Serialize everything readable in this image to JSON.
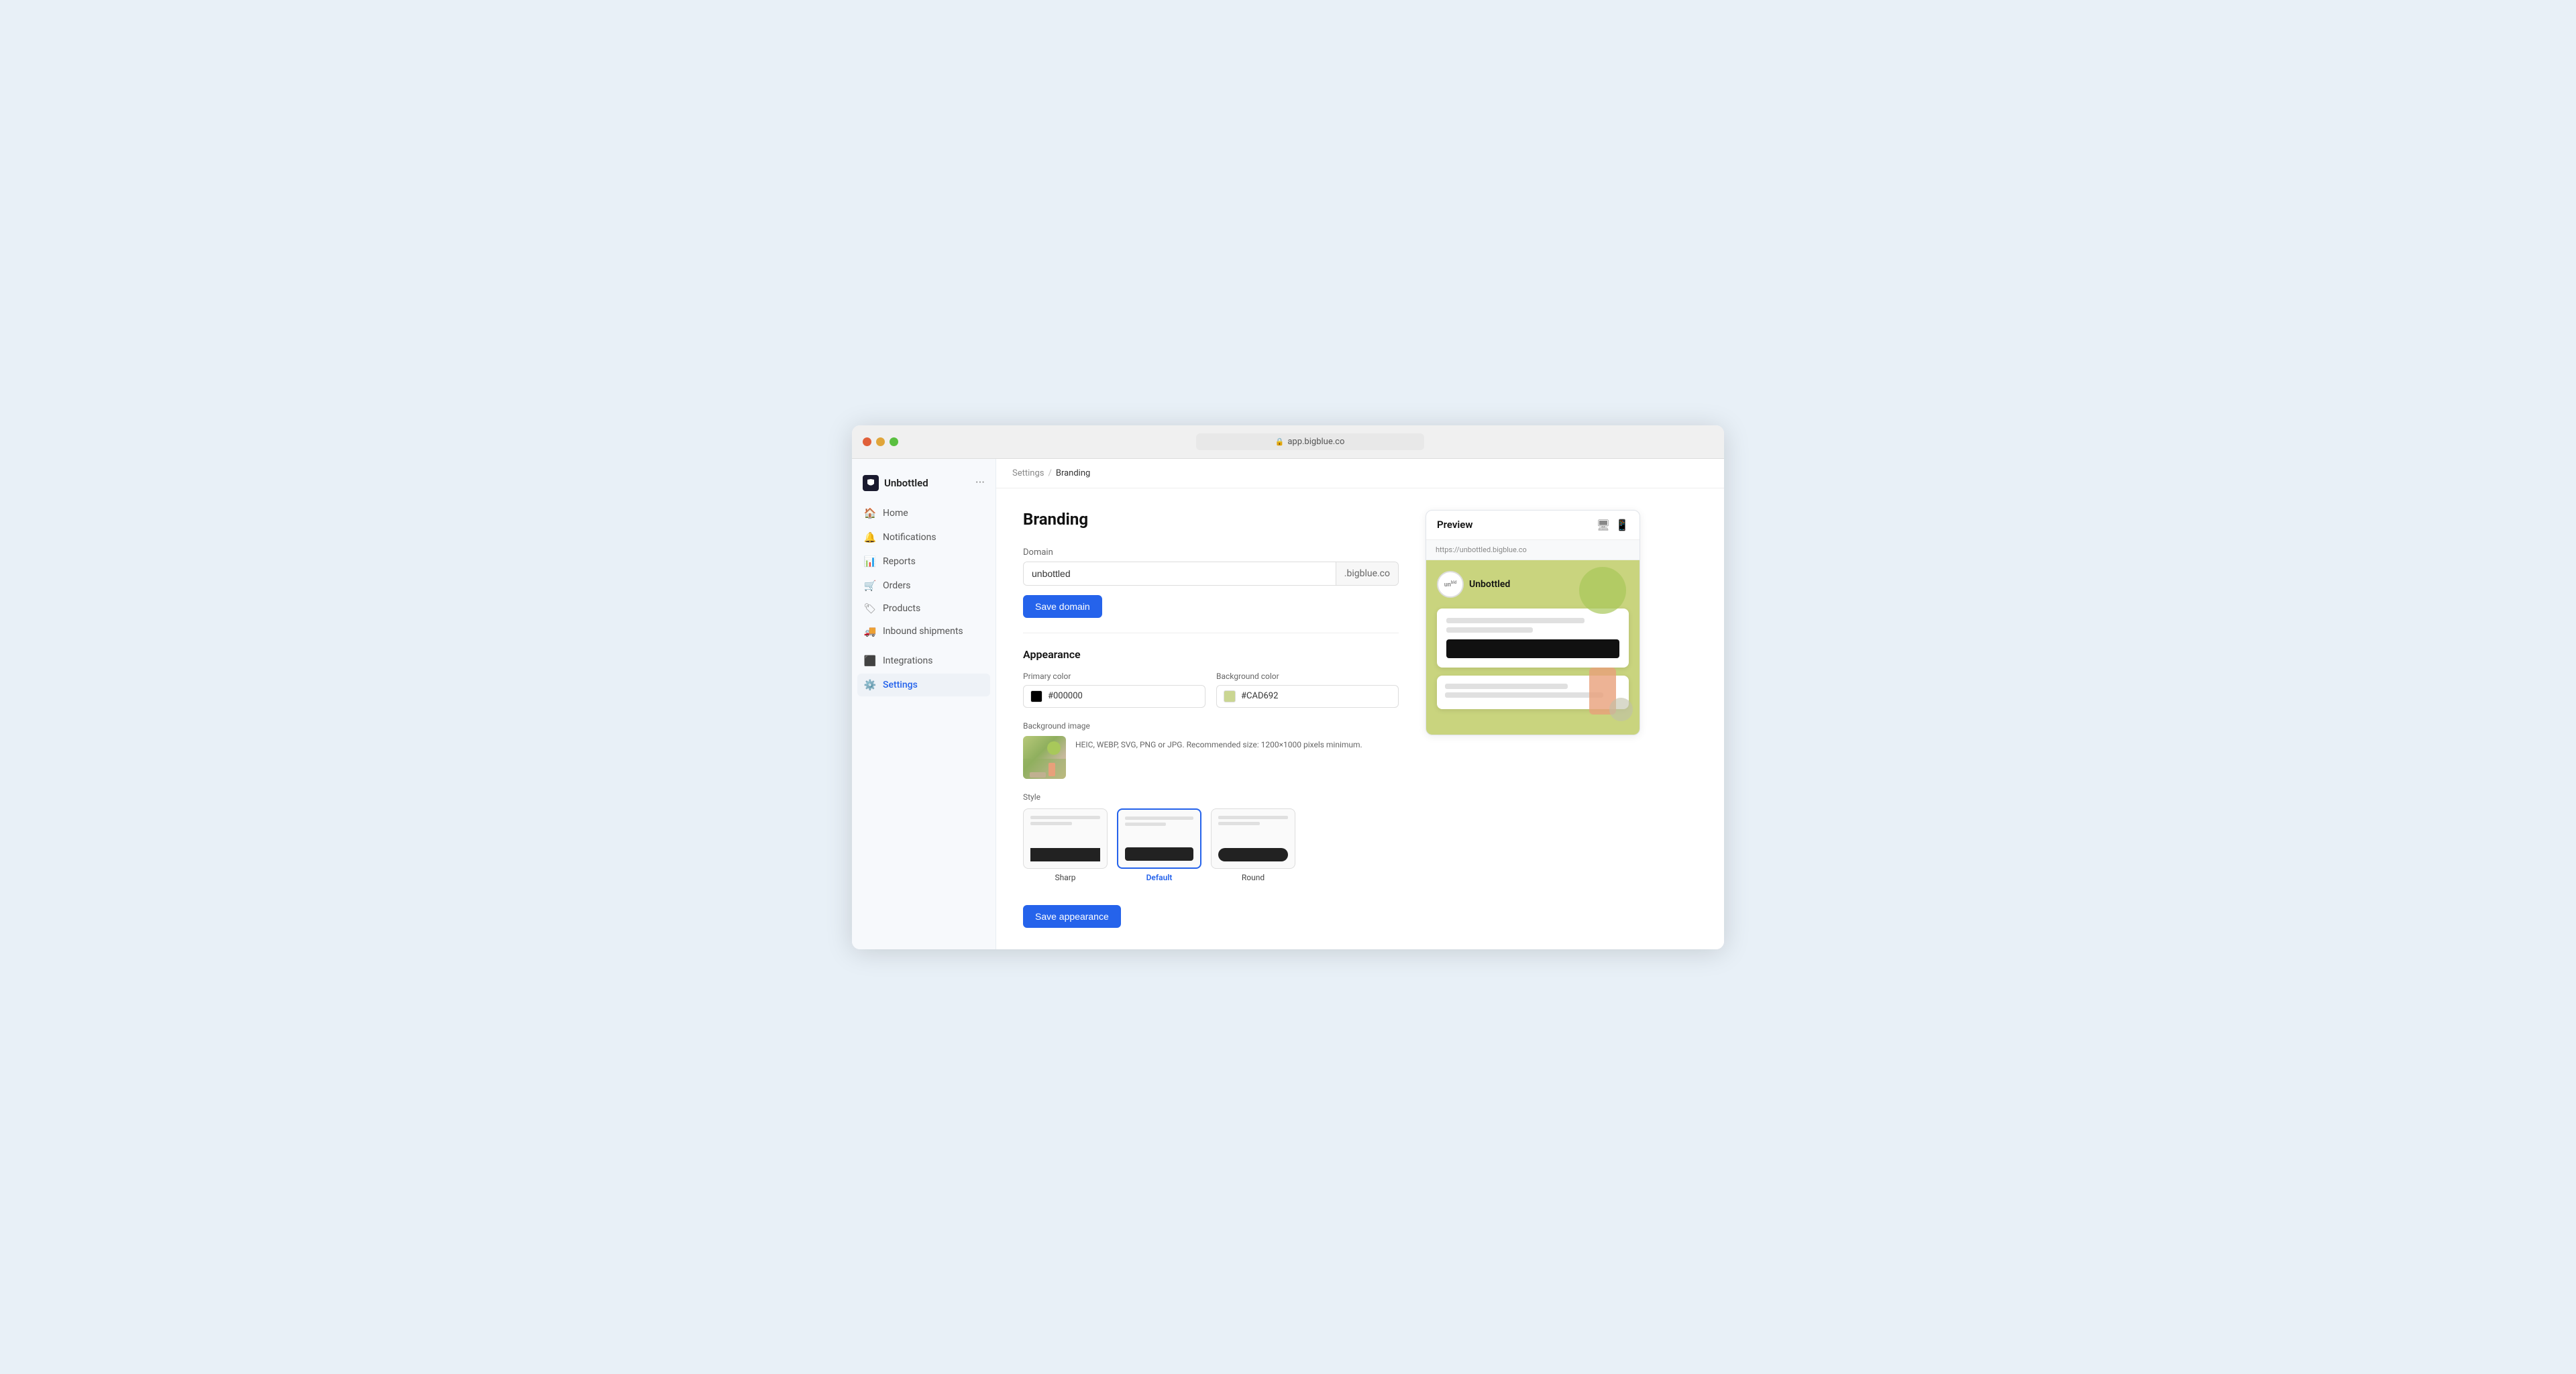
{
  "browser": {
    "url": "app.bigblue.co"
  },
  "sidebar": {
    "brand": "Unbottled",
    "nav_items": [
      {
        "id": "home",
        "label": "Home",
        "icon": "home"
      },
      {
        "id": "notifications",
        "label": "Notifications",
        "icon": "bell"
      },
      {
        "id": "reports",
        "label": "Reports",
        "icon": "bar-chart"
      },
      {
        "id": "orders",
        "label": "Orders",
        "icon": "shopping-cart"
      },
      {
        "id": "products",
        "label": "Products",
        "icon": "tag"
      },
      {
        "id": "inbound-shipments",
        "label": "Inbound shipments",
        "icon": "truck"
      },
      {
        "id": "integrations",
        "label": "Integrations",
        "icon": "grid"
      },
      {
        "id": "settings",
        "label": "Settings",
        "icon": "gear",
        "active": true
      }
    ]
  },
  "breadcrumb": {
    "parent": "Settings",
    "current": "Branding"
  },
  "page": {
    "title": "Branding",
    "domain_section": {
      "label": "Domain",
      "input_value": "unbottled",
      "suffix": ".bigblue.co",
      "save_button": "Save domain"
    },
    "appearance_section": {
      "title": "Appearance",
      "primary_color_label": "Primary color",
      "primary_color_value": "#000000",
      "background_color_label": "Background color",
      "background_color_value": "#CAD692",
      "background_image_label": "Background image",
      "background_image_hint": "HEIC, WEBP, SVG, PNG or JPG.\nRecommended size: 1200×1000 pixels minimum.",
      "style_label": "Style",
      "style_options": [
        {
          "id": "sharp",
          "label": "Sharp",
          "selected": false
        },
        {
          "id": "default",
          "label": "Default",
          "selected": true
        },
        {
          "id": "round",
          "label": "Round",
          "selected": false
        }
      ],
      "save_button": "Save appearance"
    },
    "preview": {
      "title": "Preview",
      "url": "https://unbottled.bigblue.co",
      "brand_name": "Unbottled"
    }
  }
}
